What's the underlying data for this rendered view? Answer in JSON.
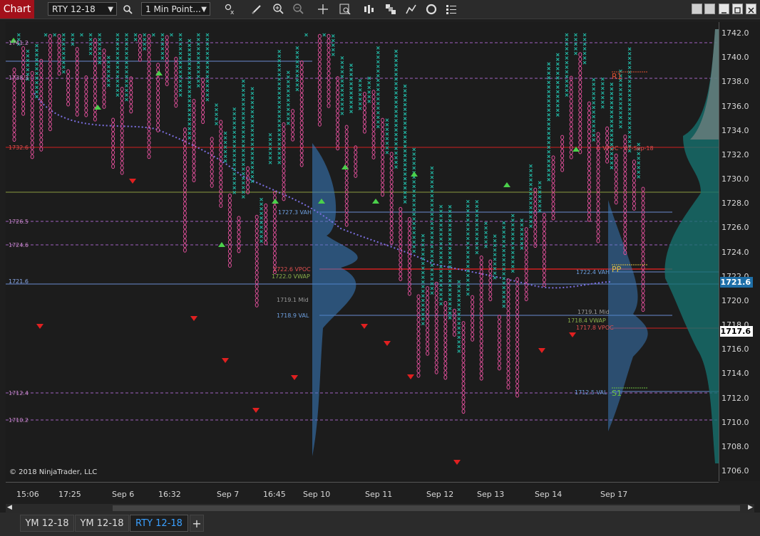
{
  "toolbar": {
    "chart_tab": "Chart",
    "instrument": "RTY 12-18",
    "interval": "1 Min Point...",
    "icons": [
      "search-icon",
      "bar-type-icon",
      "draw-icon",
      "zoom-in-icon",
      "zoom-out-icon",
      "crosshair-icon",
      "data-box-icon",
      "bar-style-icon",
      "strategies-icon",
      "indicators-icon",
      "refresh-icon",
      "properties-icon"
    ]
  },
  "price_axis": {
    "ticks": [
      "1742.0",
      "1740.0",
      "1738.0",
      "1736.0",
      "1734.0",
      "1732.0",
      "1730.0",
      "1728.0",
      "1726.0",
      "1724.0",
      "1722.0",
      "1720.0",
      "1718.0",
      "1716.0",
      "1714.0",
      "1712.0",
      "1710.0",
      "1708.0",
      "1706.0"
    ],
    "current_price": "1721.6",
    "last_price": "1717.6",
    "current_price_color": "#1e6fa8",
    "last_price_color": "#ffffff"
  },
  "time_axis": {
    "labels": [
      "15:06",
      "17:25",
      "Sep 6",
      "16:32",
      "Sep 7",
      "16:45",
      "Sep 10",
      "Sep 11",
      "Sep 12",
      "Sep 13",
      "Sep 14",
      "Sep 17"
    ]
  },
  "levels": {
    "left": [
      "1741.2",
      "1738.3",
      "1732.6",
      "1726.5",
      "1724.6",
      "1721.6",
      "1712.4",
      "1710.2"
    ],
    "profile_labels": [
      "1727.3 VAH",
      "1722.6 VPOC",
      "1722.0 VWAP",
      "1719.1 Mid",
      "1718.9 VAL",
      "1722.4 VAH",
      "1719.1 Mid",
      "1718.4 VWAP",
      "1717.8 VPOC",
      "1712.5 VAL",
      "< VPOC - 07-Sep-18"
    ],
    "pivots": [
      "R1",
      "PP",
      "S1"
    ]
  },
  "colors": {
    "x_bars": "#22b5a3",
    "o_bars": "#e04f9a",
    "up_marker": "#4bd04b",
    "down_marker": "#e02020",
    "vwap": "#7b6fe0",
    "profile": "#3b7fc4"
  },
  "copyright": "© 2018 NinjaTrader, LLC",
  "bottom_tabs": [
    "YM 12-18",
    "YM 12-18",
    "RTY 12-18"
  ],
  "add_tab": "+"
}
